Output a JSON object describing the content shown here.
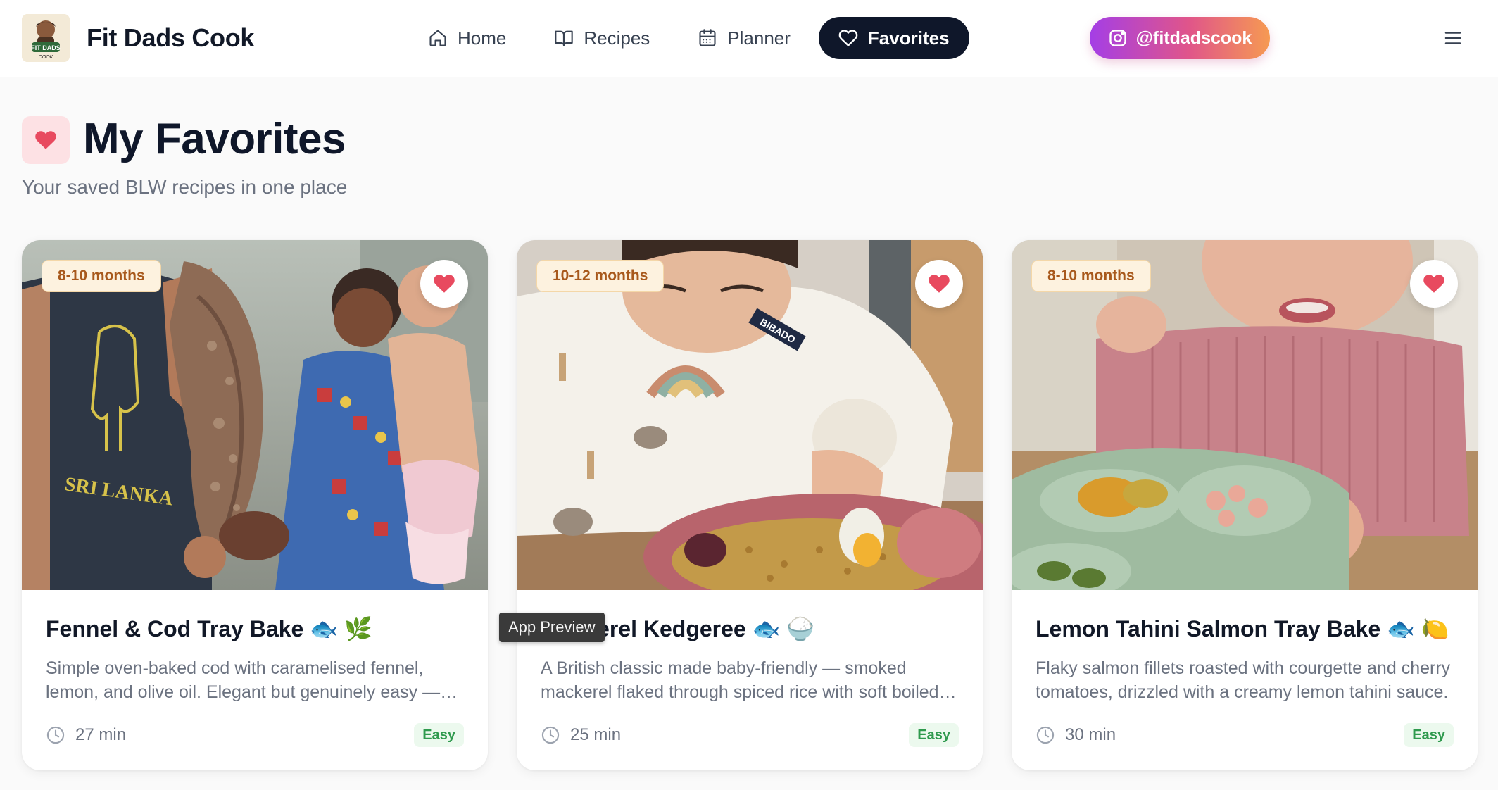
{
  "brand": {
    "title": "Fit Dads Cook",
    "logo_text_top": "FIT DADS",
    "logo_text_bottom": "COOK"
  },
  "nav": {
    "items": [
      {
        "label": "Home",
        "icon": "home-icon"
      },
      {
        "label": "Recipes",
        "icon": "book-icon"
      },
      {
        "label": "Planner",
        "icon": "calendar-icon"
      },
      {
        "label": "Favorites",
        "icon": "heart-icon",
        "active": true
      }
    ],
    "instagram_label": "@fitdadscook"
  },
  "page": {
    "title": "My Favorites",
    "subtitle": "Your saved BLW recipes in one place"
  },
  "cards": [
    {
      "age": "8-10 months",
      "title": "Fennel & Cod Tray Bake 🐟 🌿",
      "description": "Simple oven-baked cod with caramelised fennel, lemon, and olive oil. Elegant but genuinely easy — perfect for a weeknight family dinner.",
      "time": "27 min",
      "difficulty": "Easy",
      "photo_banner": "SRI LANKA"
    },
    {
      "age": "10-12 months",
      "title": "Mackerel Kedgeree 🐟 🍚",
      "description": "A British classic made baby-friendly — smoked mackerel flaked through spiced rice with soft boiled egg.",
      "time": "25 min",
      "difficulty": "Easy",
      "photo_banner": "BIBADO"
    },
    {
      "age": "8-10 months",
      "title": "Lemon Tahini Salmon Tray Bake 🐟 🍋",
      "description": "Flaky salmon fillets roasted with courgette and cherry tomatoes, drizzled with a creamy lemon tahini sauce.",
      "time": "30 min",
      "difficulty": "Easy"
    }
  ],
  "tooltip": "App Preview",
  "colors": {
    "nav_active_bg": "#0f172a",
    "heart": "#e84a5f",
    "age_badge_text": "#a8591c",
    "easy_badge_text": "#2f9a4e"
  }
}
